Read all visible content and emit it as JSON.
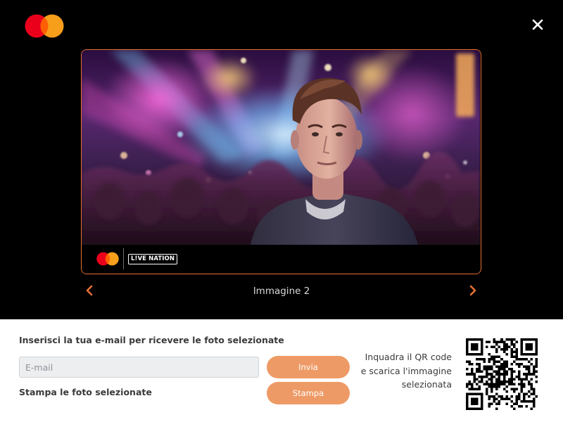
{
  "header": {
    "logo_icon": "mastercard-logo-icon",
    "close_icon": "close-icon"
  },
  "photo_card": {
    "footer_logo_icon": "mastercard-logo-icon",
    "partner_badge": "L!VE NATION"
  },
  "carousel": {
    "caption": "Immagine 2",
    "prev_icon": "chevron-left-icon",
    "next_icon": "chevron-right-icon"
  },
  "form": {
    "email_label": "Inserisci la tua e-mail per ricevere le foto selezionate",
    "email_placeholder": "E-mail",
    "email_value": "",
    "send_label": "Invia",
    "print_label": "Stampa le foto selezionate",
    "print_button_label": "Stampa"
  },
  "qr_section": {
    "line1": "Inquadra il QR code",
    "line2": "e scarica l'immagine",
    "line3": "selezionata"
  },
  "colors": {
    "accent": "#e86f32",
    "button": "#ee9a66",
    "mc_red": "#eb001b",
    "mc_orange": "#f79e1b"
  }
}
